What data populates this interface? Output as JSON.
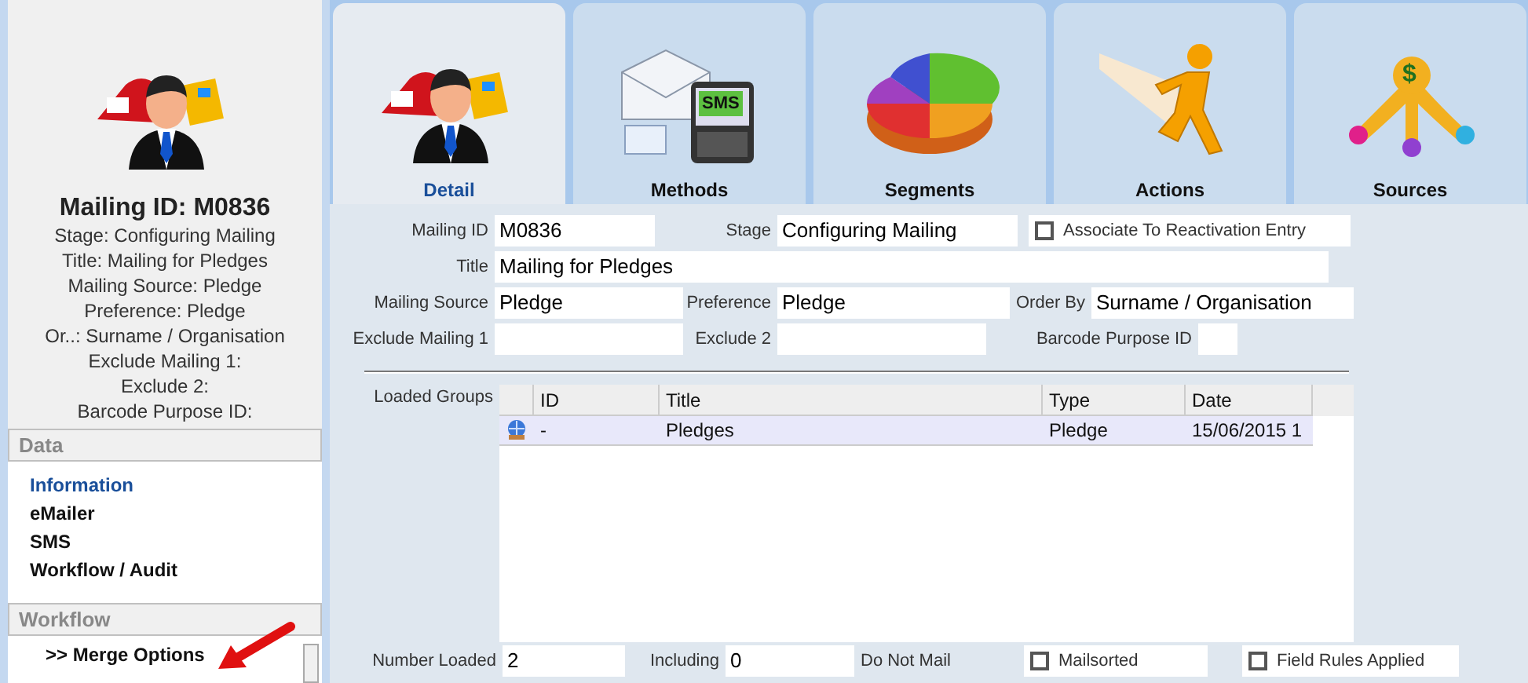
{
  "sidebar": {
    "heading": "Mailing ID: M0836",
    "summary_lines": [
      "Stage: Configuring Mailing",
      "Title: Mailing for Pledges",
      "Mailing Source: Pledge",
      "Preference: Pledge",
      "Or..: Surname / Organisation",
      "Exclude Mailing 1:",
      "Exclude 2:",
      "Barcode Purpose ID:"
    ],
    "sections": [
      {
        "title": "Data",
        "items": [
          {
            "label": "Information",
            "selected": true
          },
          {
            "label": "eMailer",
            "selected": false
          },
          {
            "label": "SMS",
            "selected": false
          },
          {
            "label": "Workflow / Audit",
            "selected": false
          }
        ]
      },
      {
        "title": "Workflow",
        "items": [
          {
            "label": ">> Merge Options",
            "selected": false
          }
        ]
      }
    ]
  },
  "tabs": [
    {
      "label": "Detail",
      "selected": true,
      "kind": "person"
    },
    {
      "label": "Methods",
      "selected": false,
      "kind": "methods",
      "icon_text": "SMS"
    },
    {
      "label": "Segments",
      "selected": false,
      "kind": "pie"
    },
    {
      "label": "Actions",
      "selected": false,
      "kind": "runner"
    },
    {
      "label": "Sources",
      "selected": false,
      "kind": "sources",
      "icon_text": "$"
    }
  ],
  "form": {
    "rows": [
      [
        {
          "kind": "text",
          "label": "Mailing ID",
          "value": "M0836"
        },
        {
          "kind": "text",
          "label": "Stage",
          "value": "Configuring Mailing"
        },
        {
          "kind": "checkbox",
          "label": "Associate To Reactivation Entry",
          "checked": false
        }
      ],
      [
        {
          "kind": "text",
          "label": "Title",
          "value": "Mailing for Pledges"
        }
      ],
      [
        {
          "kind": "text",
          "label": "Mailing Source",
          "value": "Pledge"
        },
        {
          "kind": "text",
          "label": "Preference",
          "value": "Pledge"
        },
        {
          "kind": "text",
          "label": "Order By",
          "value": "Surname / Organisation"
        }
      ],
      [
        {
          "kind": "text",
          "label": "Exclude Mailing 1"
        },
        {
          "kind": "text",
          "label": "Exclude 2"
        },
        {
          "kind": "text",
          "label": "Barcode Purpose ID"
        }
      ]
    ]
  },
  "loaded_groups": {
    "label": "Loaded Groups",
    "columns": [
      "ID",
      "Title",
      "Type",
      "Date"
    ],
    "rows": [
      {
        "selected": true,
        "cells": [
          "-",
          "Pledges",
          "Pledge",
          "15/06/2015 1"
        ]
      }
    ]
  },
  "footer": [
    {
      "kind": "text",
      "label": "Number Loaded",
      "value": "2"
    },
    {
      "kind": "text",
      "label": "Including",
      "value": "0"
    },
    {
      "kind": "label",
      "label": "Do Not Mail"
    },
    {
      "kind": "checkbox",
      "label": "Mailsorted",
      "checked": false
    },
    {
      "kind": "checkbox",
      "label": "Field Rules Applied",
      "checked": false
    }
  ]
}
